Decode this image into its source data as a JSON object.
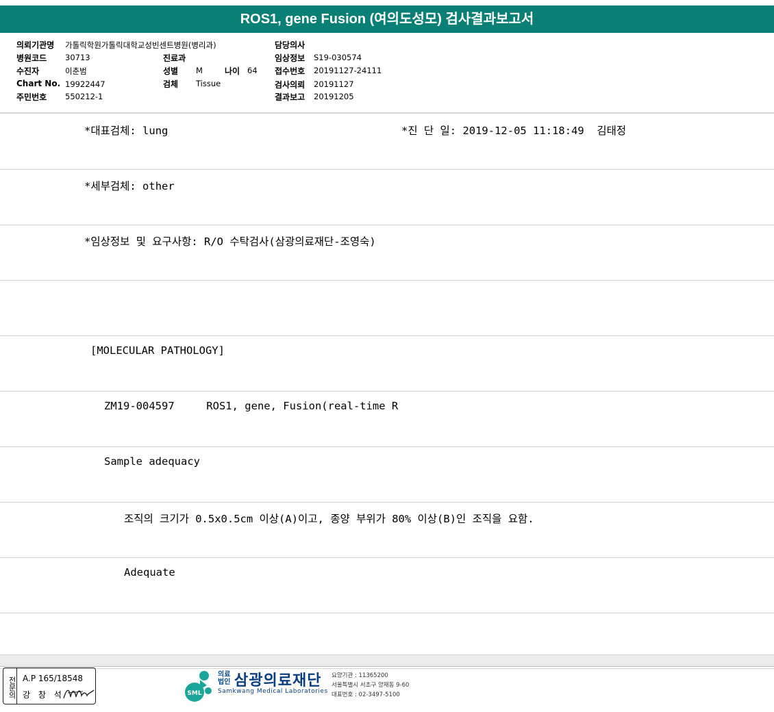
{
  "report": {
    "title": "ROS1, gene Fusion (여의도성모) 검사결과보고서"
  },
  "header": {
    "institution_label": "의뢰기관명",
    "institution_value": "가톨릭학원가톨릭대학교성빈센트병원(병리과)",
    "attending_label": "담당의사",
    "hospital_code_label": "병원코드",
    "hospital_code_value": "30713",
    "department_label": "진료과",
    "clinical_info_label": "임상정보",
    "clinical_info_value": "S19-030574",
    "patient_label": "수진자",
    "patient_value": "이춘범",
    "sex_label": "성별",
    "sex_value": "M",
    "age_label": "나이",
    "age_value": "64",
    "receipt_label": "접수번호",
    "receipt_value": "20191127-24111",
    "chart_label": "Chart No.",
    "chart_value": "19922447",
    "specimen_label": "검체",
    "specimen_value": "Tissue",
    "request_label": "검사의뢰",
    "request_value": "20191127",
    "resident_label": "주민번호",
    "resident_value": "550212-1",
    "report_label": "결과보고",
    "report_value": "20191205"
  },
  "rows": [
    {
      "left": "*대표검체: lung",
      "right": "*진 단 일: 2019-12-05 11:18:49  김태정"
    },
    {
      "left": "*세부검체: other"
    },
    {
      "left": "*임상정보 및 요구사항: R/O 수탁검사(삼광의료재단-조영숙)"
    },
    {
      "left": ""
    },
    {
      "left": "[MOLECULAR PATHOLOGY]"
    },
    {
      "left": "ZM19-004597     ROS1, gene, Fusion(real-time R"
    },
    {
      "left": "Sample adequacy"
    },
    {
      "left": "조직의 크기가 0.5x0.5cm 이상(A)이고, 종양 부위가 80% 이상(B)인 조직을 요함."
    },
    {
      "left": "Adequate"
    },
    {
      "left": ""
    }
  ],
  "footer": {
    "stamp_label": "전문의",
    "stamp_line1": "A.P 165/18548",
    "stamp_line2": "강 창 석",
    "logo_text": "SML",
    "logo_corp": "의료\n법인",
    "logo_name": "삼광의료재단",
    "logo_eng": "Samkwang Medical Laboratories",
    "info1": "요양기관 : 11365200",
    "info2": "서울특별시 서초구 양재동 9-60",
    "info3": "대표번호 : 02-3497-5100"
  },
  "colors": {
    "title_bar": "#0a7f76",
    "logo_blue": "#0a3d80",
    "logo_teal": "#1aa59a"
  }
}
